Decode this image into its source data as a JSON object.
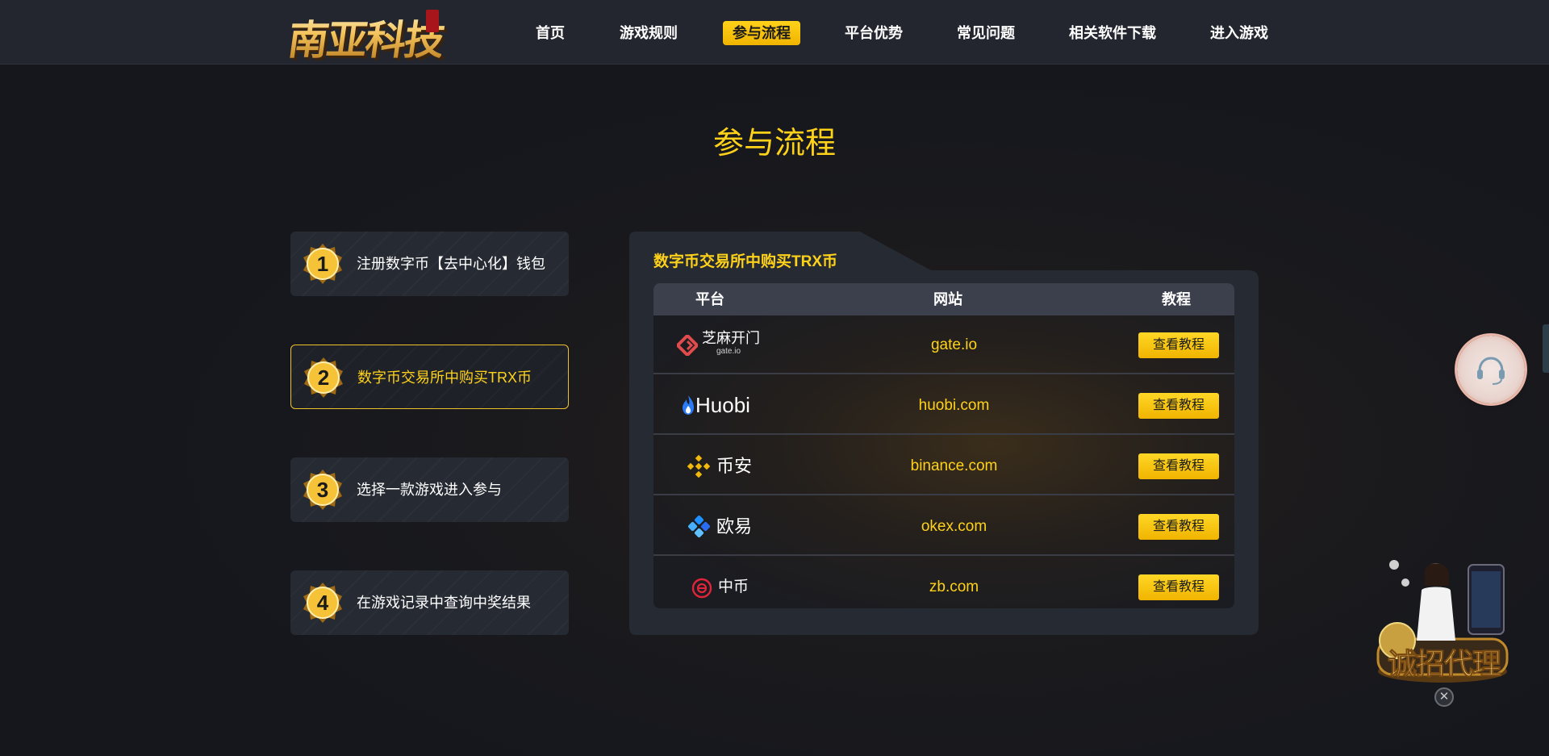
{
  "header": {
    "logo_text": "南亚科技",
    "nav": [
      {
        "label": "首页",
        "active": false
      },
      {
        "label": "游戏规则",
        "active": false
      },
      {
        "label": "参与流程",
        "active": true
      },
      {
        "label": "平台优势",
        "active": false
      },
      {
        "label": "常见问题",
        "active": false
      },
      {
        "label": "相关软件下载",
        "active": false
      },
      {
        "label": "进入游戏",
        "active": false
      }
    ]
  },
  "page_title": "参与流程",
  "steps": [
    {
      "num": "1",
      "label": "注册数字币【去中心化】钱包",
      "active": false
    },
    {
      "num": "2",
      "label": "数字币交易所中购买TRX币",
      "active": true
    },
    {
      "num": "3",
      "label": "选择一款游戏进入参与",
      "active": false
    },
    {
      "num": "4",
      "label": "在游戏记录中查询中奖结果",
      "active": false
    }
  ],
  "panel": {
    "title": "数字币交易所中购买TRX币",
    "columns": {
      "platform": "平台",
      "site": "网站",
      "tutorial": "教程"
    },
    "rows": [
      {
        "platform": "芝麻开门",
        "platform_sub": "gate.io",
        "site": "gate.io",
        "button": "查看教程",
        "logo": "gate-logo-icon"
      },
      {
        "platform": "Huobi",
        "site": "huobi.com",
        "button": "查看教程",
        "logo": "huobi-flame-icon"
      },
      {
        "platform": "币安",
        "site": "binance.com",
        "button": "查看教程",
        "logo": "binance-diamond-icon"
      },
      {
        "platform": "欧易",
        "site": "okex.com",
        "button": "查看教程",
        "logo": "okex-cluster-icon"
      },
      {
        "platform": "中币",
        "site": "zb.com",
        "button": "查看教程",
        "logo": "zb-circle-icon"
      }
    ]
  },
  "widgets": {
    "agent_banner_text": "诚招代理",
    "close_symbol": "✕"
  },
  "colors": {
    "accent": "#ffd21a",
    "header_bg": "#23262f",
    "page_bg": "#15171d",
    "card_bg": "#262a33"
  }
}
